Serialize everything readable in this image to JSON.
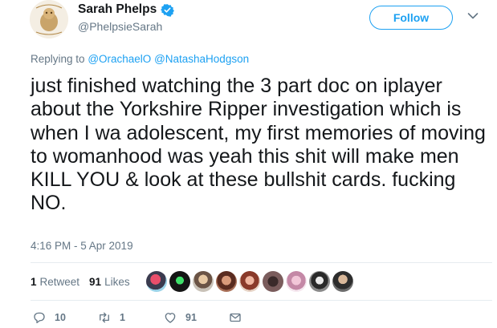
{
  "author": {
    "display_name": "Sarah Phelps",
    "handle": "@PhelpsieSarah",
    "verified_icon": "verified-badge-icon"
  },
  "follow_label": "Follow",
  "reply": {
    "prefix": "Replying to",
    "mentions": [
      "@OrachaelO",
      "@NatashaHodgson"
    ]
  },
  "tweet_text": "just finished watching the 3 part doc on iplayer about the Yorkshire Ripper investigation which is when I wa adolescent, my first memories of moving to womanhood was yeah this shit will make men KILL YOU & look at these bullshit cards. fucking NO.",
  "timestamp": "4:16 PM - 5 Apr 2019",
  "stats": {
    "retweets_count": "1",
    "retweets_label": "Retweet",
    "likes_count": "91",
    "likes_label": "Likes"
  },
  "likers_count": 9,
  "actions": {
    "replies": "10",
    "retweets": "1",
    "likes": "91"
  },
  "colors": {
    "accent": "#1da1f2",
    "secondary_text": "#657786",
    "divider": "#e6ecf0"
  }
}
